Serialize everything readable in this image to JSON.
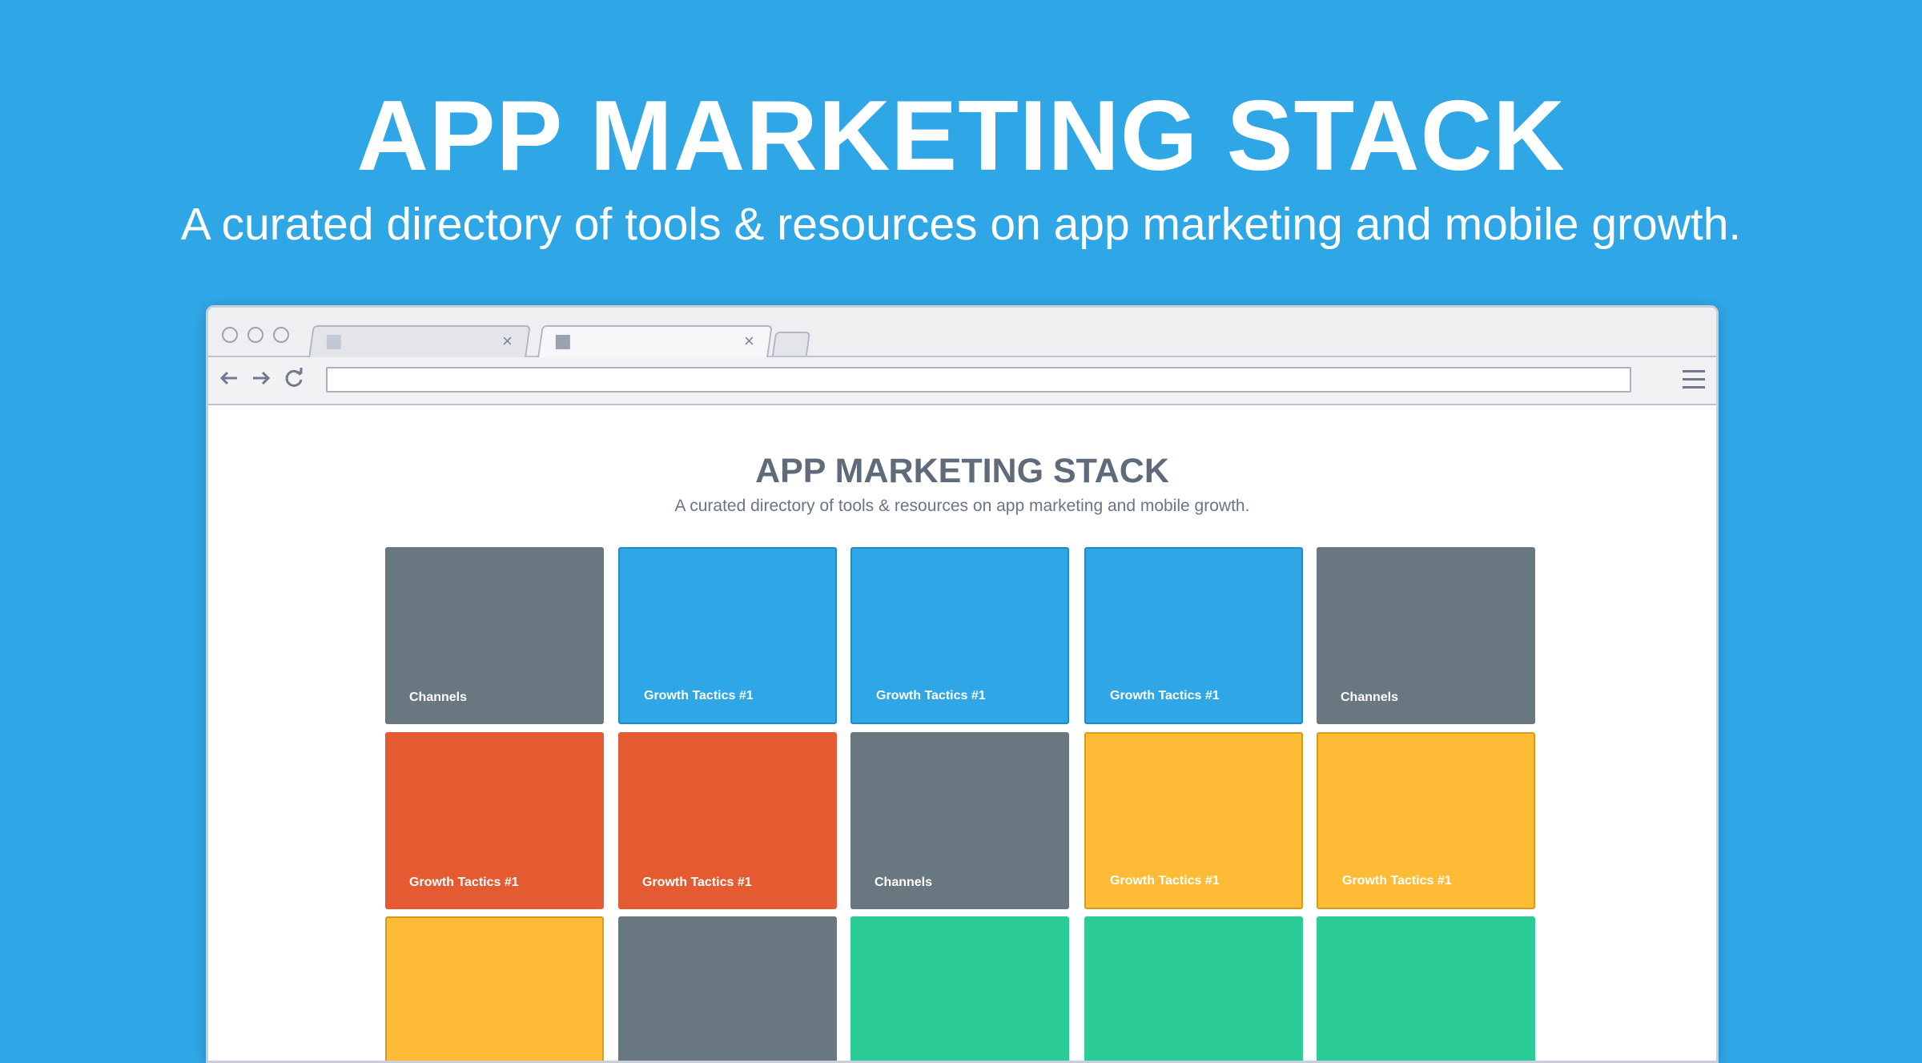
{
  "hero": {
    "title": "APP MARKETING STACK",
    "subtitle": "A curated directory of tools & resources on app marketing and mobile growth."
  },
  "browser": {
    "tabs": [
      {
        "close": "×",
        "active": false
      },
      {
        "close": "×",
        "active": true
      }
    ],
    "toolbar": {
      "back_icon": "arrow-left-icon",
      "forward_icon": "arrow-right-icon",
      "reload_icon": "reload-icon",
      "menu_icon": "hamburger-menu-icon",
      "address_value": ""
    }
  },
  "page": {
    "title": "APP MARKETING STACK",
    "subtitle": "A curated directory of tools & resources on app marketing and mobile growth."
  },
  "colors": {
    "background": "#2fa6e6",
    "gray": "#687780",
    "blue": "#2fa6e6",
    "orange": "#e45b31",
    "yellow": "#fdbb36",
    "green": "#2ccc96"
  },
  "tiles": [
    {
      "label": "Channels",
      "color": "gray"
    },
    {
      "label": "Growth Tactics #1",
      "color": "blue"
    },
    {
      "label": "Growth Tactics #1",
      "color": "blue"
    },
    {
      "label": "Growth Tactics #1",
      "color": "blue"
    },
    {
      "label": "Channels",
      "color": "gray"
    },
    {
      "label": "Growth Tactics #1",
      "color": "orange"
    },
    {
      "label": "Growth Tactics #1",
      "color": "orange"
    },
    {
      "label": "Channels",
      "color": "gray"
    },
    {
      "label": "Growth Tactics #1",
      "color": "yellow"
    },
    {
      "label": "Growth Tactics #1",
      "color": "yellow"
    },
    {
      "label": "",
      "color": "yellow"
    },
    {
      "label": "",
      "color": "gray"
    },
    {
      "label": "",
      "color": "green"
    },
    {
      "label": "",
      "color": "green"
    },
    {
      "label": "",
      "color": "green"
    }
  ]
}
